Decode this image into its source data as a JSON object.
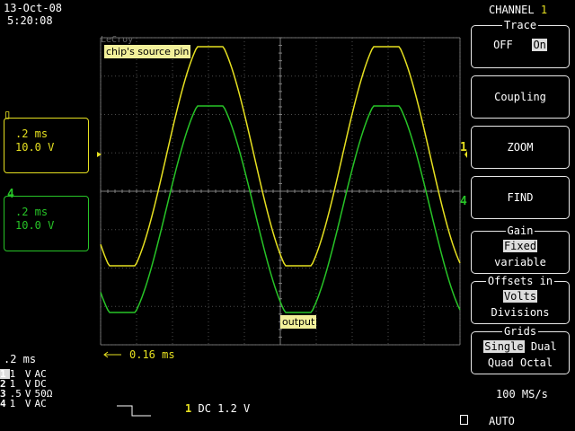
{
  "header": {
    "date": "13-Oct-08",
    "time": "5:20:08",
    "watermark": "LeCroy",
    "channel_title": "CHANNEL",
    "channel_number": "1"
  },
  "menu": {
    "trace": {
      "title": "Trace",
      "off": "OFF",
      "on": "On"
    },
    "coupling": "Coupling",
    "zoom": "ZOOM",
    "find": "FIND",
    "gain": {
      "title": "Gain",
      "fixed": "Fixed",
      "variable": "variable"
    },
    "offsets": {
      "title": "Offsets in",
      "volts": "Volts",
      "divisions": "Divisions"
    },
    "grids": {
      "title": "Grids",
      "single": "Single",
      "dual": "Dual",
      "quad": "Quad",
      "octal": "Octal"
    }
  },
  "channels_side": [
    {
      "id": "1",
      "timebase": ".2 ms",
      "volts": "10.0 V"
    },
    {
      "id": "4",
      "timebase": ".2 ms",
      "volts": "10.0 V"
    }
  ],
  "traces": {
    "top_label": "chip's source pin",
    "bottom_label": "output"
  },
  "measure": {
    "delta": "0.16 ms"
  },
  "timebase": ".2 ms",
  "channel_table": [
    {
      "num": "1",
      "val": "1",
      "unit": "V",
      "coupling": "AC"
    },
    {
      "num": "2",
      "val": "1",
      "unit": "V",
      "coupling": "DC"
    },
    {
      "num": "3",
      "val": ".5",
      "unit": "V",
      "coupling": "50Ω"
    },
    {
      "num": "4",
      "val": "1",
      "unit": "V",
      "coupling": "AC"
    }
  ],
  "trigger": {
    "channel": "1",
    "coupling": "DC",
    "level": "1.2 V"
  },
  "sample_rate": "100 MS/s",
  "mode": "AUTO",
  "colors": {
    "ch1": "#e6e020",
    "ch4": "#27c427",
    "grid": "#8a8a8a"
  }
}
